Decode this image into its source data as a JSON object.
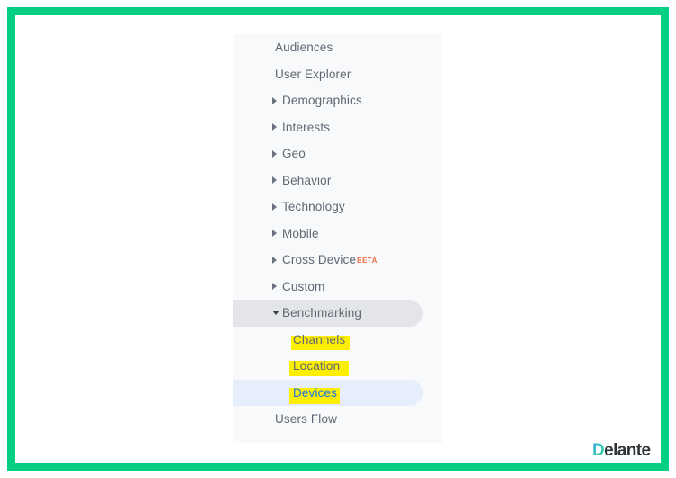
{
  "frame": {
    "border_color": "#05cf82"
  },
  "nav": {
    "panel_background": "#f8f9fa",
    "items": [
      {
        "label": "Audiences",
        "level": "plain",
        "arrow": "none",
        "state": "default"
      },
      {
        "label": "User Explorer",
        "level": "plain",
        "arrow": "none",
        "state": "default"
      },
      {
        "label": "Demographics",
        "level": "group",
        "arrow": "right",
        "state": "default"
      },
      {
        "label": "Interests",
        "level": "group",
        "arrow": "right",
        "state": "default"
      },
      {
        "label": "Geo",
        "level": "group",
        "arrow": "right",
        "state": "default"
      },
      {
        "label": "Behavior",
        "level": "group",
        "arrow": "right",
        "state": "default"
      },
      {
        "label": "Technology",
        "level": "group",
        "arrow": "right",
        "state": "default"
      },
      {
        "label": "Mobile",
        "level": "group",
        "arrow": "right",
        "state": "default"
      },
      {
        "label": "Cross Device",
        "level": "group",
        "arrow": "right",
        "state": "default",
        "badge": "BETA"
      },
      {
        "label": "Custom",
        "level": "group",
        "arrow": "right",
        "state": "default"
      },
      {
        "label": "Benchmarking",
        "level": "group",
        "arrow": "down",
        "state": "expanded"
      },
      {
        "label": "Channels",
        "level": "sub",
        "arrow": "none",
        "state": "highlighted"
      },
      {
        "label": "Location",
        "level": "sub",
        "arrow": "none",
        "state": "highlighted"
      },
      {
        "label": "Devices",
        "level": "sub",
        "arrow": "none",
        "state": "selected"
      },
      {
        "label": "Users Flow",
        "level": "plain",
        "arrow": "none",
        "state": "default"
      }
    ],
    "badge_label": "BETA",
    "badge_color": "#ec6b42",
    "highlight_color": "#fcee04",
    "selected_row_color": "#e6eefb",
    "expanded_row_color": "#e4e5e8",
    "selected_text_color": "#1a73e8",
    "text_color": "#5f6673"
  },
  "logo": {
    "first_letter": "D",
    "remainder": "elante"
  }
}
